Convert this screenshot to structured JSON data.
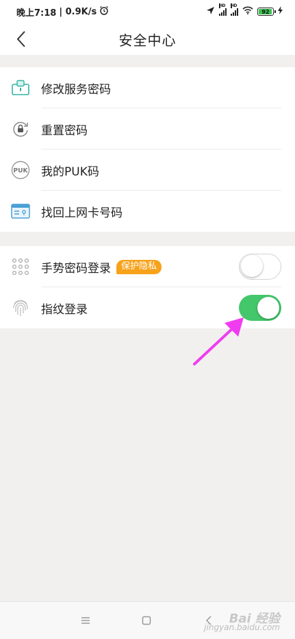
{
  "status_bar": {
    "time": "晚上7:18",
    "speed": "| 0.9K/s",
    "battery_level": "92",
    "signal_labels": [
      "HD",
      "HD"
    ]
  },
  "header": {
    "title": "安全中心"
  },
  "section1": {
    "items": [
      {
        "label": "修改服务密码",
        "icon": "lock-card-icon"
      },
      {
        "label": "重置密码",
        "icon": "reset-lock-icon"
      },
      {
        "label": "我的PUK码",
        "icon": "puk-icon"
      },
      {
        "label": "找回上网卡号码",
        "icon": "sim-card-icon"
      }
    ]
  },
  "section2": {
    "items": [
      {
        "label": "手势密码登录",
        "badge": "保护隐私",
        "icon": "gesture-dots-icon",
        "toggle": "off"
      },
      {
        "label": "指纹登录",
        "icon": "fingerprint-icon",
        "toggle": "on"
      }
    ]
  },
  "watermark": {
    "brand": "Bai 经验",
    "url": "jingyan.baidu.com"
  },
  "colors": {
    "accent_teal": "#2fb5a3",
    "toggle_on": "#43c76a",
    "badge": "#f7a21b",
    "arrow": "#f03cf0"
  }
}
